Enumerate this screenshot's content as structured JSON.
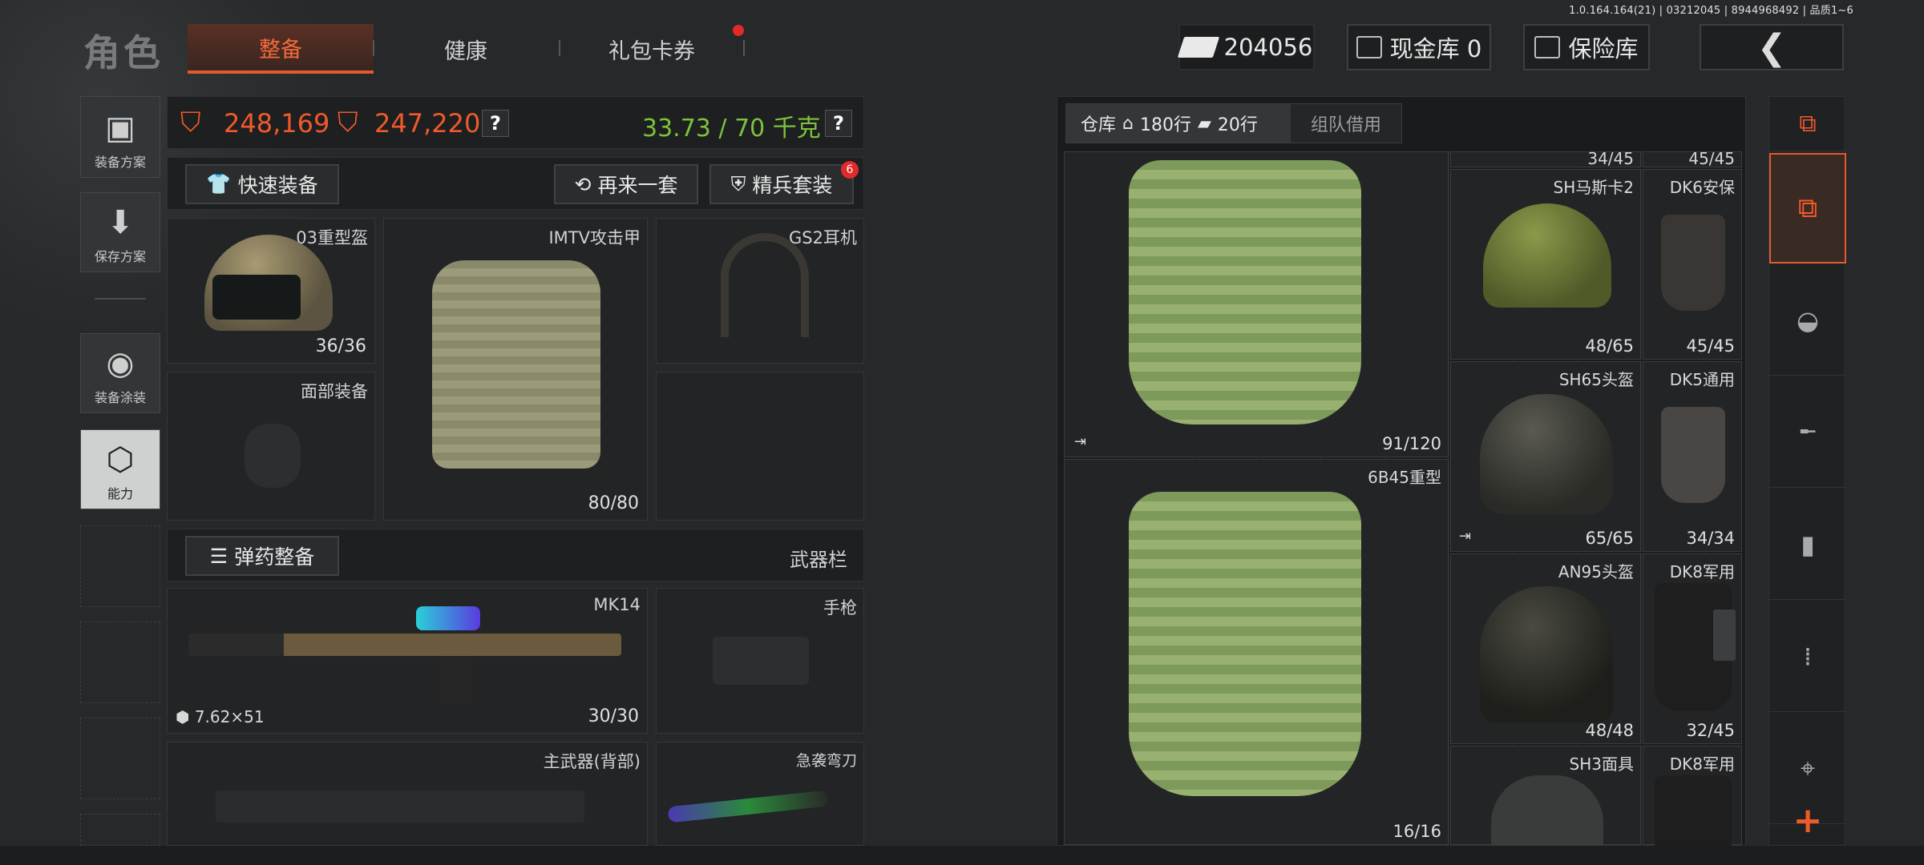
{
  "version": "1.0.164.164(21) | 03212045 | 8944968492 | 品质1~6",
  "page_title": "角色",
  "tabs": [
    {
      "label": "整备",
      "active": true
    },
    {
      "label": "健康"
    },
    {
      "label": "礼包卡券"
    }
  ],
  "header": {
    "money": "204056",
    "cash_vault": "现金库 0",
    "insurance": "保险库"
  },
  "side_buttons": [
    "装备方案",
    "保存方案",
    "装备涂装",
    "能力"
  ],
  "stats": {
    "value1": "248,169",
    "value2": "247,220",
    "weight": "33.73 / 70 千克"
  },
  "loadout_buttons": {
    "quick": "快速装备",
    "again": "再来一套",
    "elite": "精兵套装",
    "elite_badge": "6"
  },
  "slots": {
    "helmet": {
      "label": "03重型盔",
      "dur": "36/36"
    },
    "armor": {
      "label": "IMTV攻击甲",
      "dur": "80/80"
    },
    "headset": {
      "label": "GS2耳机"
    },
    "face": {
      "label": "面部装备"
    },
    "ammo_btn": "弹药整备",
    "weapon_bar": "武器栏",
    "primary": {
      "label": "MK14",
      "dur": "30/30",
      "ammo": "7.62×51"
    },
    "pistol": {
      "label": "手枪"
    },
    "back": {
      "label": "主武器(背部)"
    },
    "knife": {
      "label": "急袭弯刀"
    }
  },
  "inventory": {
    "tabs": {
      "warehouse": "仓库",
      "rows1": "180行",
      "rows2": "20行",
      "team": "组队借用"
    },
    "items": [
      {
        "label": "",
        "dur": "91/120"
      },
      {
        "label": "6B45重型",
        "dur": "16/16"
      },
      {
        "label": "",
        "dur": "34/45"
      },
      {
        "label": "",
        "dur": "45/45"
      },
      {
        "label": "SH马斯卡2",
        "dur": "48/65"
      },
      {
        "label": "DK6安保",
        "dur": "45/45"
      },
      {
        "label": "SH65头盔",
        "dur": "65/65"
      },
      {
        "label": "DK5通用",
        "dur": "34/34"
      },
      {
        "label": "AN95头盔",
        "dur": "48/48"
      },
      {
        "label": "DK8军用",
        "dur": "32/45"
      },
      {
        "label": "SH3面具",
        "dur": ""
      },
      {
        "label": "DK8军用",
        "dur": ""
      }
    ]
  }
}
